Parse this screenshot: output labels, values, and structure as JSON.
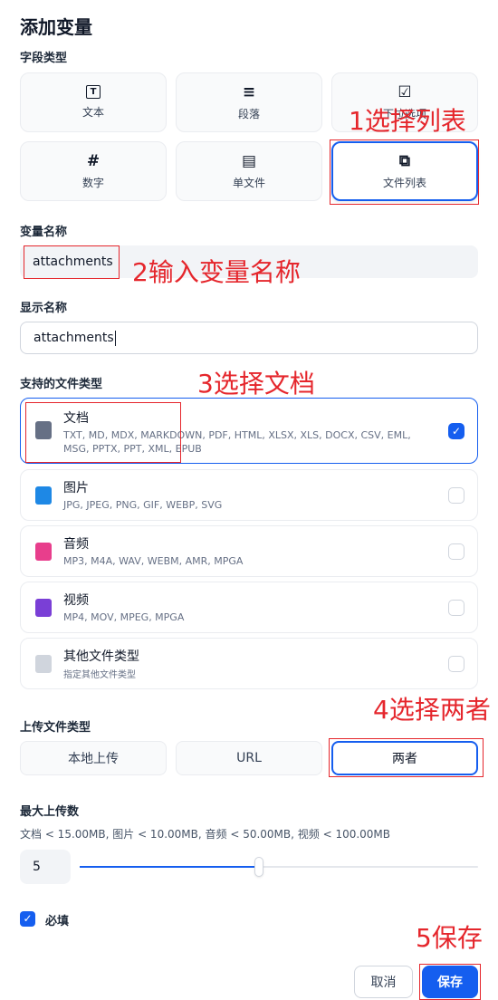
{
  "title": "添加变量",
  "field_type": {
    "label": "字段类型",
    "options": [
      {
        "icon": "text-icon",
        "glyph": "🅃",
        "label": "文本"
      },
      {
        "icon": "paragraph-icon",
        "glyph": "≡",
        "label": "段落"
      },
      {
        "icon": "select-icon",
        "glyph": "☑",
        "label": "下拉选项"
      },
      {
        "icon": "number-icon",
        "glyph": "#",
        "label": "数字"
      },
      {
        "icon": "single-file-icon",
        "glyph": "▤",
        "label": "单文件"
      },
      {
        "icon": "file-list-icon",
        "glyph": "⧉",
        "label": "文件列表"
      }
    ],
    "selected": "文件列表"
  },
  "variable_name": {
    "label": "变量名称",
    "value": "attachments"
  },
  "display_name": {
    "label": "显示名称",
    "value": "attachments"
  },
  "file_types": {
    "label": "支持的文件类型",
    "items": [
      {
        "name": "文档",
        "desc": "TXT, MD, MDX, MARKDOWN, PDF, HTML, XLSX, XLS, DOCX, CSV, EML, MSG, PPTX, PPT, XML, EPUB",
        "checked": true,
        "color": "#667085",
        "icon": "document-icon"
      },
      {
        "name": "图片",
        "desc": "JPG, JPEG, PNG, GIF, WEBP, SVG",
        "checked": false,
        "color": "#1e88e5",
        "icon": "image-icon"
      },
      {
        "name": "音频",
        "desc": "MP3, M4A, WAV, WEBM, AMR, MPGA",
        "checked": false,
        "color": "#e83e8c",
        "icon": "audio-icon"
      },
      {
        "name": "视频",
        "desc": "MP4, MOV, MPEG, MPGA",
        "checked": false,
        "color": "#7a3fd6",
        "icon": "video-icon"
      },
      {
        "name": "其他文件类型",
        "desc": "指定其他文件类型",
        "checked": false,
        "color": "#d0d5dd",
        "icon": "other-file-icon"
      }
    ]
  },
  "upload_type": {
    "label": "上传文件类型",
    "options": [
      "本地上传",
      "URL",
      "两者"
    ],
    "selected": "两者"
  },
  "max_uploads": {
    "label": "最大上传数",
    "limits": "文档 < 15.00MB, 图片 < 10.00MB, 音频 < 50.00MB, 视频 < 100.00MB",
    "value": "5",
    "slider_fraction": 0.5
  },
  "required": {
    "label": "必填",
    "checked": true
  },
  "buttons": {
    "cancel": "取消",
    "save": "保存"
  },
  "annotations": {
    "step1": "1选择列表",
    "step2": "2输入变量名称",
    "step3": "3选择文档",
    "step4": "4选择两者",
    "step5": "5保存"
  },
  "colors": {
    "accent": "#155eef",
    "annotation": "#e5262c"
  }
}
